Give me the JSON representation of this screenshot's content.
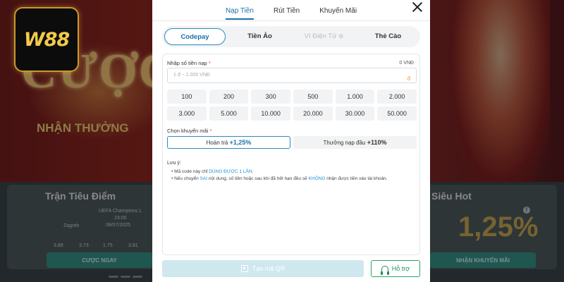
{
  "background": {
    "hero_text": "CƯỢC CASI",
    "hero_sub": "NHẬN THƯỞNG",
    "logo_text": "W88",
    "section_left": "Trận Tiêu Điểm",
    "section_right": "Siêu Hot",
    "match_league": "UEFA Champions L",
    "match_time": "23:00",
    "match_date": "08/07/2025",
    "match_team": "Zagreb",
    "odds": [
      "3.89",
      "3.73",
      "1.75",
      "3.81"
    ],
    "left_button": "CƯỢC NGAY",
    "right_button": "NHẬN KHUYẾN MÃI",
    "big_number": "1,25%",
    "info_icon": "!"
  },
  "modal": {
    "top_tabs": [
      {
        "label": "Nạp Tiền",
        "active": true
      },
      {
        "label": "Rút Tiền",
        "active": false
      },
      {
        "label": "Khuyến Mãi",
        "active": false
      }
    ],
    "methods": [
      {
        "label": "Codepay",
        "state": "active"
      },
      {
        "label": "Tiền Ảo",
        "state": "normal"
      },
      {
        "label": "Ví Điện Tử",
        "state": "disabled",
        "icon": "gear-icon"
      },
      {
        "label": "Thẻ Cào",
        "state": "normal"
      }
    ],
    "amount": {
      "label": "Nhập số tiền nạp",
      "required_mark": "*",
      "balance": "0 VNĐ",
      "placeholder": "1 đ ~ 1.000 VNĐ",
      "currency_symbol": "đ"
    },
    "quick_amounts": [
      "100",
      "200",
      "300",
      "500",
      "1.000",
      "2.000",
      "3.000",
      "5.000",
      "10.000",
      "20.000",
      "30.000",
      "50.000"
    ],
    "promo": {
      "label": "Chọn khuyến mãi",
      "required_mark": "*",
      "options": [
        {
          "prefix": "Hoàn trả",
          "value": "+1,25%",
          "active": true
        },
        {
          "prefix": "Thưởng nạp đầu",
          "value": "+110%",
          "active": false
        }
      ]
    },
    "notes": {
      "title": "Lưu ý:",
      "line1_pre": "Mã code này chỉ ",
      "line1_hl": "DÙNG ĐƯỢC 1 LẦN",
      "line1_post": ".",
      "line2_pre": "Nếu chuyển ",
      "line2_hl1": "SAI",
      "line2_mid": " nội dung, số tiền hoặc sau khi đã hết hạn đều sẽ ",
      "line2_hl2": "KHÔNG",
      "line2_post": " nhận được tiền vào tài khoản."
    },
    "qr_button": "Tạo mã QR",
    "help_button": "Hỗ trợ"
  },
  "colors": {
    "primary": "#1d6fa5",
    "accent_green": "#2aa36b",
    "disabled_btn": "#cfe8ee",
    "required": "#e53935"
  }
}
